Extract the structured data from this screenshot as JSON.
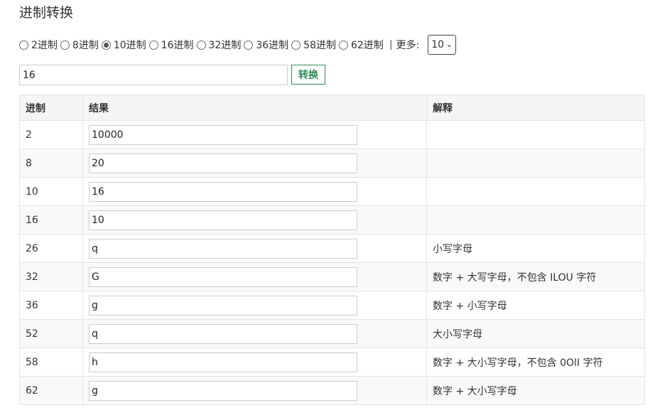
{
  "page": {
    "title": "进制转换"
  },
  "radix_options": [
    {
      "label": "2进制",
      "checked": false
    },
    {
      "label": "8进制",
      "checked": false
    },
    {
      "label": "10进制",
      "checked": true
    },
    {
      "label": "16进制",
      "checked": false
    },
    {
      "label": "32进制",
      "checked": false
    },
    {
      "label": "36进制",
      "checked": false
    },
    {
      "label": "58进制",
      "checked": false
    },
    {
      "label": "62进制",
      "checked": false
    }
  ],
  "more": {
    "separator": "|",
    "label": "更多:",
    "selected": "10"
  },
  "input": {
    "value": "16"
  },
  "convert_button": {
    "label": "转换"
  },
  "table": {
    "headers": {
      "base": "进制",
      "result": "结果",
      "explanation": "解释"
    },
    "rows": [
      {
        "base": "2",
        "result": "10000",
        "explanation": ""
      },
      {
        "base": "8",
        "result": "20",
        "explanation": ""
      },
      {
        "base": "10",
        "result": "16",
        "explanation": ""
      },
      {
        "base": "16",
        "result": "10",
        "explanation": ""
      },
      {
        "base": "26",
        "result": "q",
        "explanation": "小写字母"
      },
      {
        "base": "32",
        "result": "G",
        "explanation": "数字 + 大写字母，不包含 ILOU 字符"
      },
      {
        "base": "36",
        "result": "g",
        "explanation": "数字 + 小写字母"
      },
      {
        "base": "52",
        "result": "q",
        "explanation": "大小写字母"
      },
      {
        "base": "58",
        "result": "h",
        "explanation": "数字 + 大小写字母，不包含 0OlI 字符"
      },
      {
        "base": "62",
        "result": "g",
        "explanation": "数字 + 大小写字母"
      }
    ]
  }
}
